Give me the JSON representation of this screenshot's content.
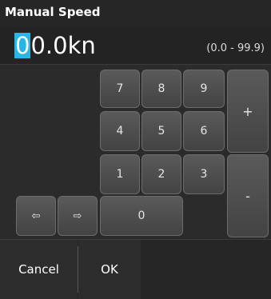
{
  "dialog": {
    "title": "Manual Speed",
    "value": {
      "cursor_digit": "0",
      "rest": "0.0kn"
    },
    "range_hint": "(0.0 - 99.9)"
  },
  "keypad": {
    "digits": [
      "7",
      "8",
      "9",
      "4",
      "5",
      "6",
      "1",
      "2",
      "3",
      "0"
    ],
    "plus_label": "+",
    "minus_label": "-",
    "left_arrow_glyph": "⇦",
    "right_arrow_glyph": "⇨"
  },
  "actions": {
    "cancel_label": "Cancel",
    "ok_label": "OK"
  },
  "colors": {
    "background": "#262626",
    "key_face": "#4e4e4e",
    "cursor_highlight": "#29b6e6"
  }
}
